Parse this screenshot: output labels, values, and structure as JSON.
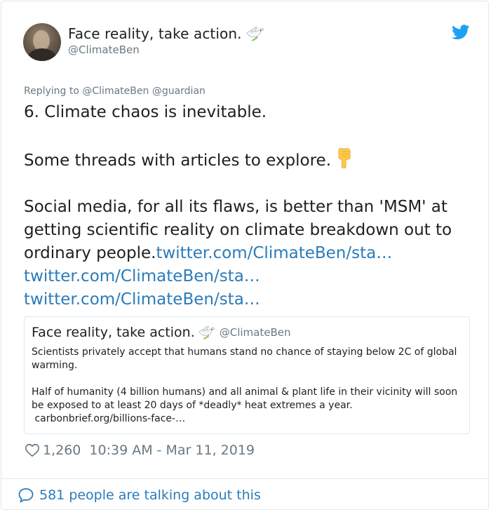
{
  "author": {
    "display_name": "Face reality, take action.",
    "handle": "@ClimateBen",
    "name_emoji_icon": "dove-of-peace-icon"
  },
  "reply_context": {
    "prefix": "Replying to",
    "mention_1": "@ClimateBen",
    "mention_2": "@guardian"
  },
  "tweet": {
    "line_1": "6. Climate chaos is inevitable.",
    "line_2": "Some threads with articles to explore.",
    "line_2_emoji_icon": "backhand-index-pointing-down-icon",
    "line_3_text": "Social media, for all its flaws, is better than 'MSM' at getting scientific reality on climate breakdown out to ordinary people.",
    "link_1": "twitter.com/ClimateBen/sta…",
    "link_2": "twitter.com/ClimateBen/sta…",
    "link_3": "twitter.com/ClimateBen/sta…"
  },
  "quoted_tweet": {
    "display_name": "Face reality, take action.",
    "handle": "@ClimateBen",
    "paragraph_1": "Scientists privately accept that humans stand no chance of staying below 2C of global warming.",
    "paragraph_2": "Half of humanity (4 billion humans) and all animal & plant life in their vicinity will soon be exposed to at least 20 days of *deadly* heat extremes a year.",
    "link": "carbonbrief.org/billions-face-…"
  },
  "footer": {
    "like_count": "1,260",
    "timestamp": "10:39 AM - Mar 11, 2019",
    "conversation_label": "581 people are talking about this"
  },
  "colors": {
    "link_blue": "#2b7bb9",
    "twitter_blue": "#1da1f2",
    "muted_gray": "#697882",
    "text": "#1c2022",
    "border": "#e1e8ed"
  }
}
